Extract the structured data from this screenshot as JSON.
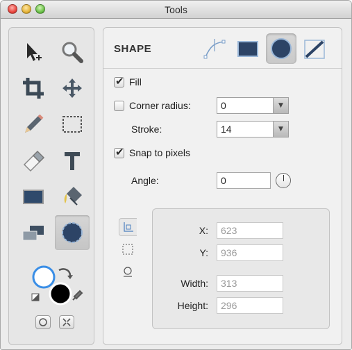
{
  "window": {
    "title": "Tools"
  },
  "tools": [
    {
      "name": "select-tool",
      "icon": "arrow-cursor-icon",
      "active": false
    },
    {
      "name": "zoom-tool",
      "icon": "magnifier-icon",
      "active": false
    },
    {
      "name": "crop-tool",
      "icon": "crop-icon",
      "active": false
    },
    {
      "name": "move-tool",
      "icon": "move-arrows-icon",
      "active": false
    },
    {
      "name": "pencil-tool",
      "icon": "pencil-icon",
      "active": false
    },
    {
      "name": "marquee-tool",
      "icon": "marquee-icon",
      "active": false
    },
    {
      "name": "eraser-tool",
      "icon": "eraser-icon",
      "active": false
    },
    {
      "name": "text-tool",
      "icon": "text-icon",
      "active": false
    },
    {
      "name": "rectangle-tool",
      "icon": "rectangle-icon",
      "active": false
    },
    {
      "name": "fill-tool",
      "icon": "paint-bucket-icon",
      "active": false
    },
    {
      "name": "layers-tool",
      "icon": "layers-icon",
      "active": false
    },
    {
      "name": "shape-tool",
      "icon": "ellipse-icon",
      "active": true
    }
  ],
  "shape": {
    "title": "SHAPE",
    "types": [
      "line-shape-icon",
      "rectangle-shape-icon",
      "ellipse-shape-icon",
      "diagonal-line-icon"
    ],
    "selected_type": "ellipse-shape-icon"
  },
  "options": {
    "fill_label": "Fill",
    "fill_checked": true,
    "corner_label": "Corner radius:",
    "corner_checked": false,
    "corner_value": "0",
    "stroke_label": "Stroke:",
    "stroke_value": "14",
    "snap_label": "Snap to pixels",
    "snap_checked": true,
    "angle_label": "Angle:",
    "angle_value": "0"
  },
  "geometry": {
    "x_label": "X:",
    "x_value": "623",
    "y_label": "Y:",
    "y_value": "936",
    "width_label": "Width:",
    "width_value": "313",
    "height_label": "Height:",
    "height_value": "296"
  },
  "colors": {
    "stroke": "#ffffff",
    "fill": "#000000",
    "accent": "#3a8ee6",
    "shape_blue": "#2d4466"
  }
}
